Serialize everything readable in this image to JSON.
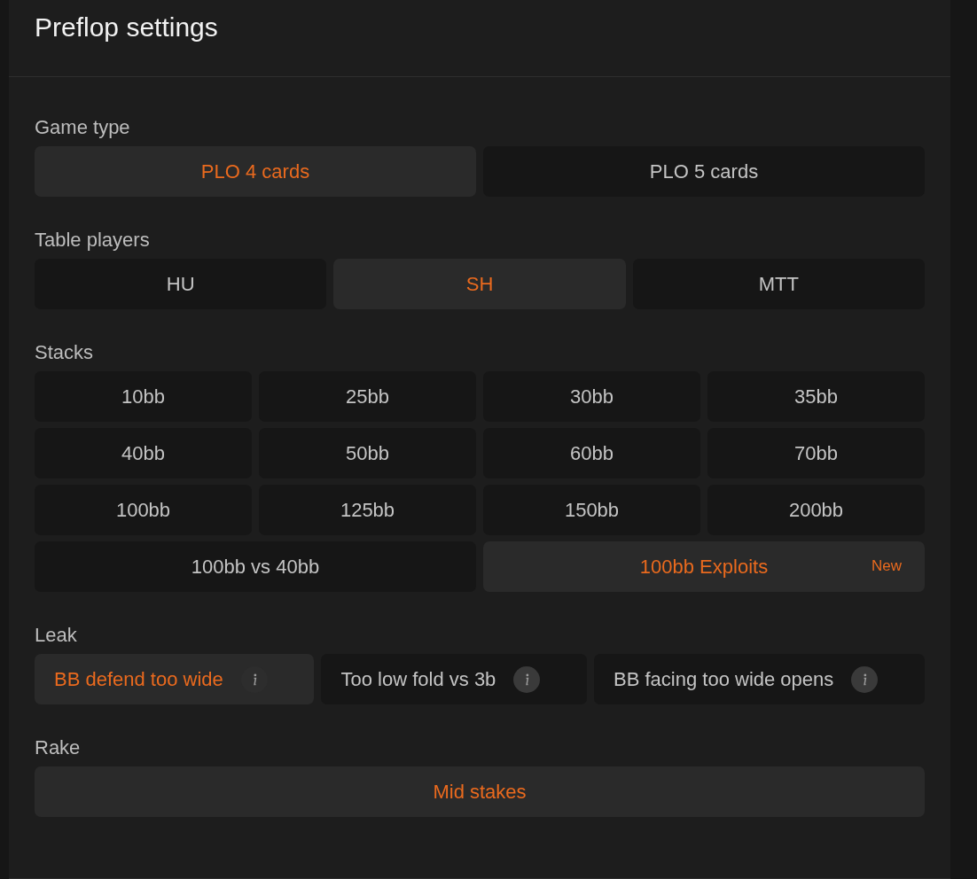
{
  "title": "Preflop settings",
  "game_type": {
    "label": "Game type",
    "options": [
      {
        "label": "PLO 4 cards",
        "selected": true
      },
      {
        "label": "PLO 5 cards",
        "selected": false
      }
    ]
  },
  "table_players": {
    "label": "Table players",
    "options": [
      {
        "label": "HU",
        "selected": false
      },
      {
        "label": "SH",
        "selected": true
      },
      {
        "label": "MTT",
        "selected": false
      }
    ]
  },
  "stacks": {
    "label": "Stacks",
    "options": [
      {
        "label": "10bb",
        "selected": false
      },
      {
        "label": "25bb",
        "selected": false
      },
      {
        "label": "30bb",
        "selected": false
      },
      {
        "label": "35bb",
        "selected": false
      },
      {
        "label": "40bb",
        "selected": false
      },
      {
        "label": "50bb",
        "selected": false
      },
      {
        "label": "60bb",
        "selected": false
      },
      {
        "label": "70bb",
        "selected": false
      },
      {
        "label": "100bb",
        "selected": false
      },
      {
        "label": "125bb",
        "selected": false
      },
      {
        "label": "150bb",
        "selected": false
      },
      {
        "label": "200bb",
        "selected": false
      }
    ],
    "wide_options": [
      {
        "label": "100bb vs 40bb",
        "selected": false
      },
      {
        "label": "100bb Exploits",
        "selected": true,
        "badge": "New"
      }
    ]
  },
  "leak": {
    "label": "Leak",
    "options": [
      {
        "label": "BB defend too wide",
        "selected": true
      },
      {
        "label": "Too low fold vs 3b",
        "selected": false
      },
      {
        "label": "BB facing too wide opens",
        "selected": false
      }
    ]
  },
  "rake": {
    "label": "Rake",
    "options": [
      {
        "label": "Mid stakes",
        "selected": true
      }
    ]
  }
}
